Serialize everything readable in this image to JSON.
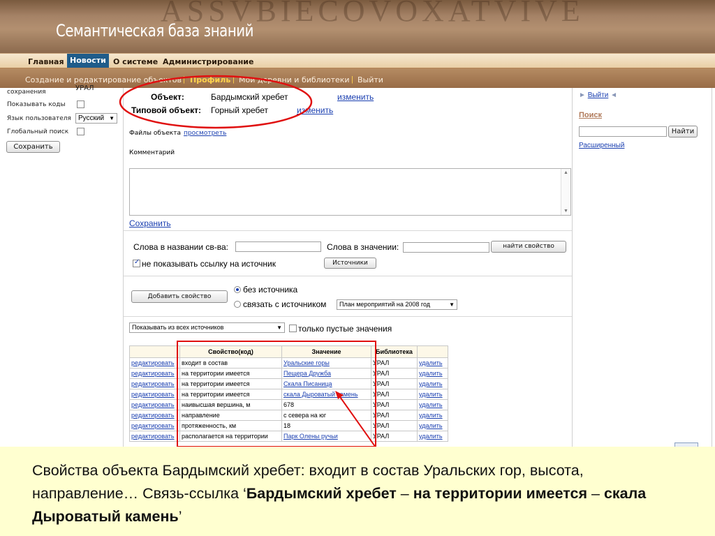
{
  "header": {
    "stone_text": "ASSVBIECOVOXATVIVE",
    "site_title": "Семантическая база знаний"
  },
  "menu": {
    "items": [
      "Главная",
      "Новости",
      "О системе",
      "Администрирование"
    ]
  },
  "submenu": {
    "items": [
      "Создание и редактирование объектов",
      "Профиль",
      "Мои деревни и библиотеки",
      "Выйти"
    ],
    "active": "Профиль",
    "separator": "|"
  },
  "left_panel": {
    "top_label": "сохранения",
    "top_value": "УРАЛ",
    "show_codes_label": "Показывать коды",
    "user_lang_label": "Язык пользователя",
    "user_lang_value": "Русский",
    "global_search_label": "Глобальный поиск",
    "save_button": "Сохранить"
  },
  "object": {
    "object_label": "Объект:",
    "object_value": "Бардымский хребет",
    "change_link": "изменить",
    "type_label": "Типовой объект:",
    "type_value": "Горный хребет",
    "type_change_link": "изменить",
    "files_label": "Файлы объекта",
    "files_link": "просмотреть",
    "comment_label": "Комментарий",
    "save_link": "Сохранить"
  },
  "search_props": {
    "name_label": "Слова в названии св-ва:",
    "value_label": "Слова в значении:",
    "find_button": "найти свойство",
    "hide_source_label": "не показывать ссылку на источник",
    "sources_button": "Источники"
  },
  "add_property": {
    "button": "Добавить свойство",
    "option_no_source": "без источника",
    "option_with_source": "связать с источником",
    "source_select": "План мероприятий на 2008 год"
  },
  "filter": {
    "sources_select": "Показывать из всех источников",
    "empty_only_label": "только пустые значения"
  },
  "table": {
    "headers": [
      "",
      "Свойство(код)",
      "Значение",
      "Библиотека",
      ""
    ],
    "rows": [
      {
        "edit": "редактировать",
        "property": "входит в состав",
        "value": "Уральские горы",
        "value_is_link": true,
        "library": "УРАЛ",
        "delete": "удалить"
      },
      {
        "edit": "редактировать",
        "property": "на территории имеется",
        "value": "Пещера Дружба",
        "value_is_link": true,
        "library": "УРАЛ",
        "delete": "удалить"
      },
      {
        "edit": "редактировать",
        "property": "на территории имеется",
        "value": "Скала Писаница",
        "value_is_link": true,
        "library": "УРАЛ",
        "delete": "удалить"
      },
      {
        "edit": "редактировать",
        "property": "на территории имеется",
        "value": "скала Дыроватый камень",
        "value_is_link": true,
        "library": "УРАЛ",
        "delete": "удалить"
      },
      {
        "edit": "редактировать",
        "property": "наивысшая вершина, м",
        "value": "678",
        "value_is_link": false,
        "library": "УРАЛ",
        "delete": "удалить"
      },
      {
        "edit": "редактировать",
        "property": "направление",
        "value": "с севера на юг",
        "value_is_link": false,
        "library": "УРАЛ",
        "delete": "удалить"
      },
      {
        "edit": "редактировать",
        "property": "протяженность, км",
        "value": "18",
        "value_is_link": false,
        "library": "УРАЛ",
        "delete": "удалить"
      },
      {
        "edit": "редактировать",
        "property": "располагается на территории",
        "value": "Парк Олены ручьи",
        "value_is_link": true,
        "library": "УРАЛ",
        "delete": "удалить"
      }
    ]
  },
  "right_panel": {
    "logout_link": "Выйти",
    "search_title": "Поиск",
    "find_button": "Найти",
    "advanced_link": "Расширенный"
  },
  "caption": {
    "part1": "Свойства объекта Бардымский хребет: входит в состав Уральских гор, высота, направление… Связь-ссылка ‘",
    "bold1": "Бардымский хребет",
    "dash1": " – ",
    "bold2": "на территории имеется",
    "dash2": " – ",
    "bold3": "скала Дыроватый камень",
    "end": "’"
  },
  "colors": {
    "link": "#1a3fb0",
    "menu_active_bg": "#1f5c8a",
    "annotation_red": "#e01010",
    "caption_bg": "#ffffd0"
  }
}
